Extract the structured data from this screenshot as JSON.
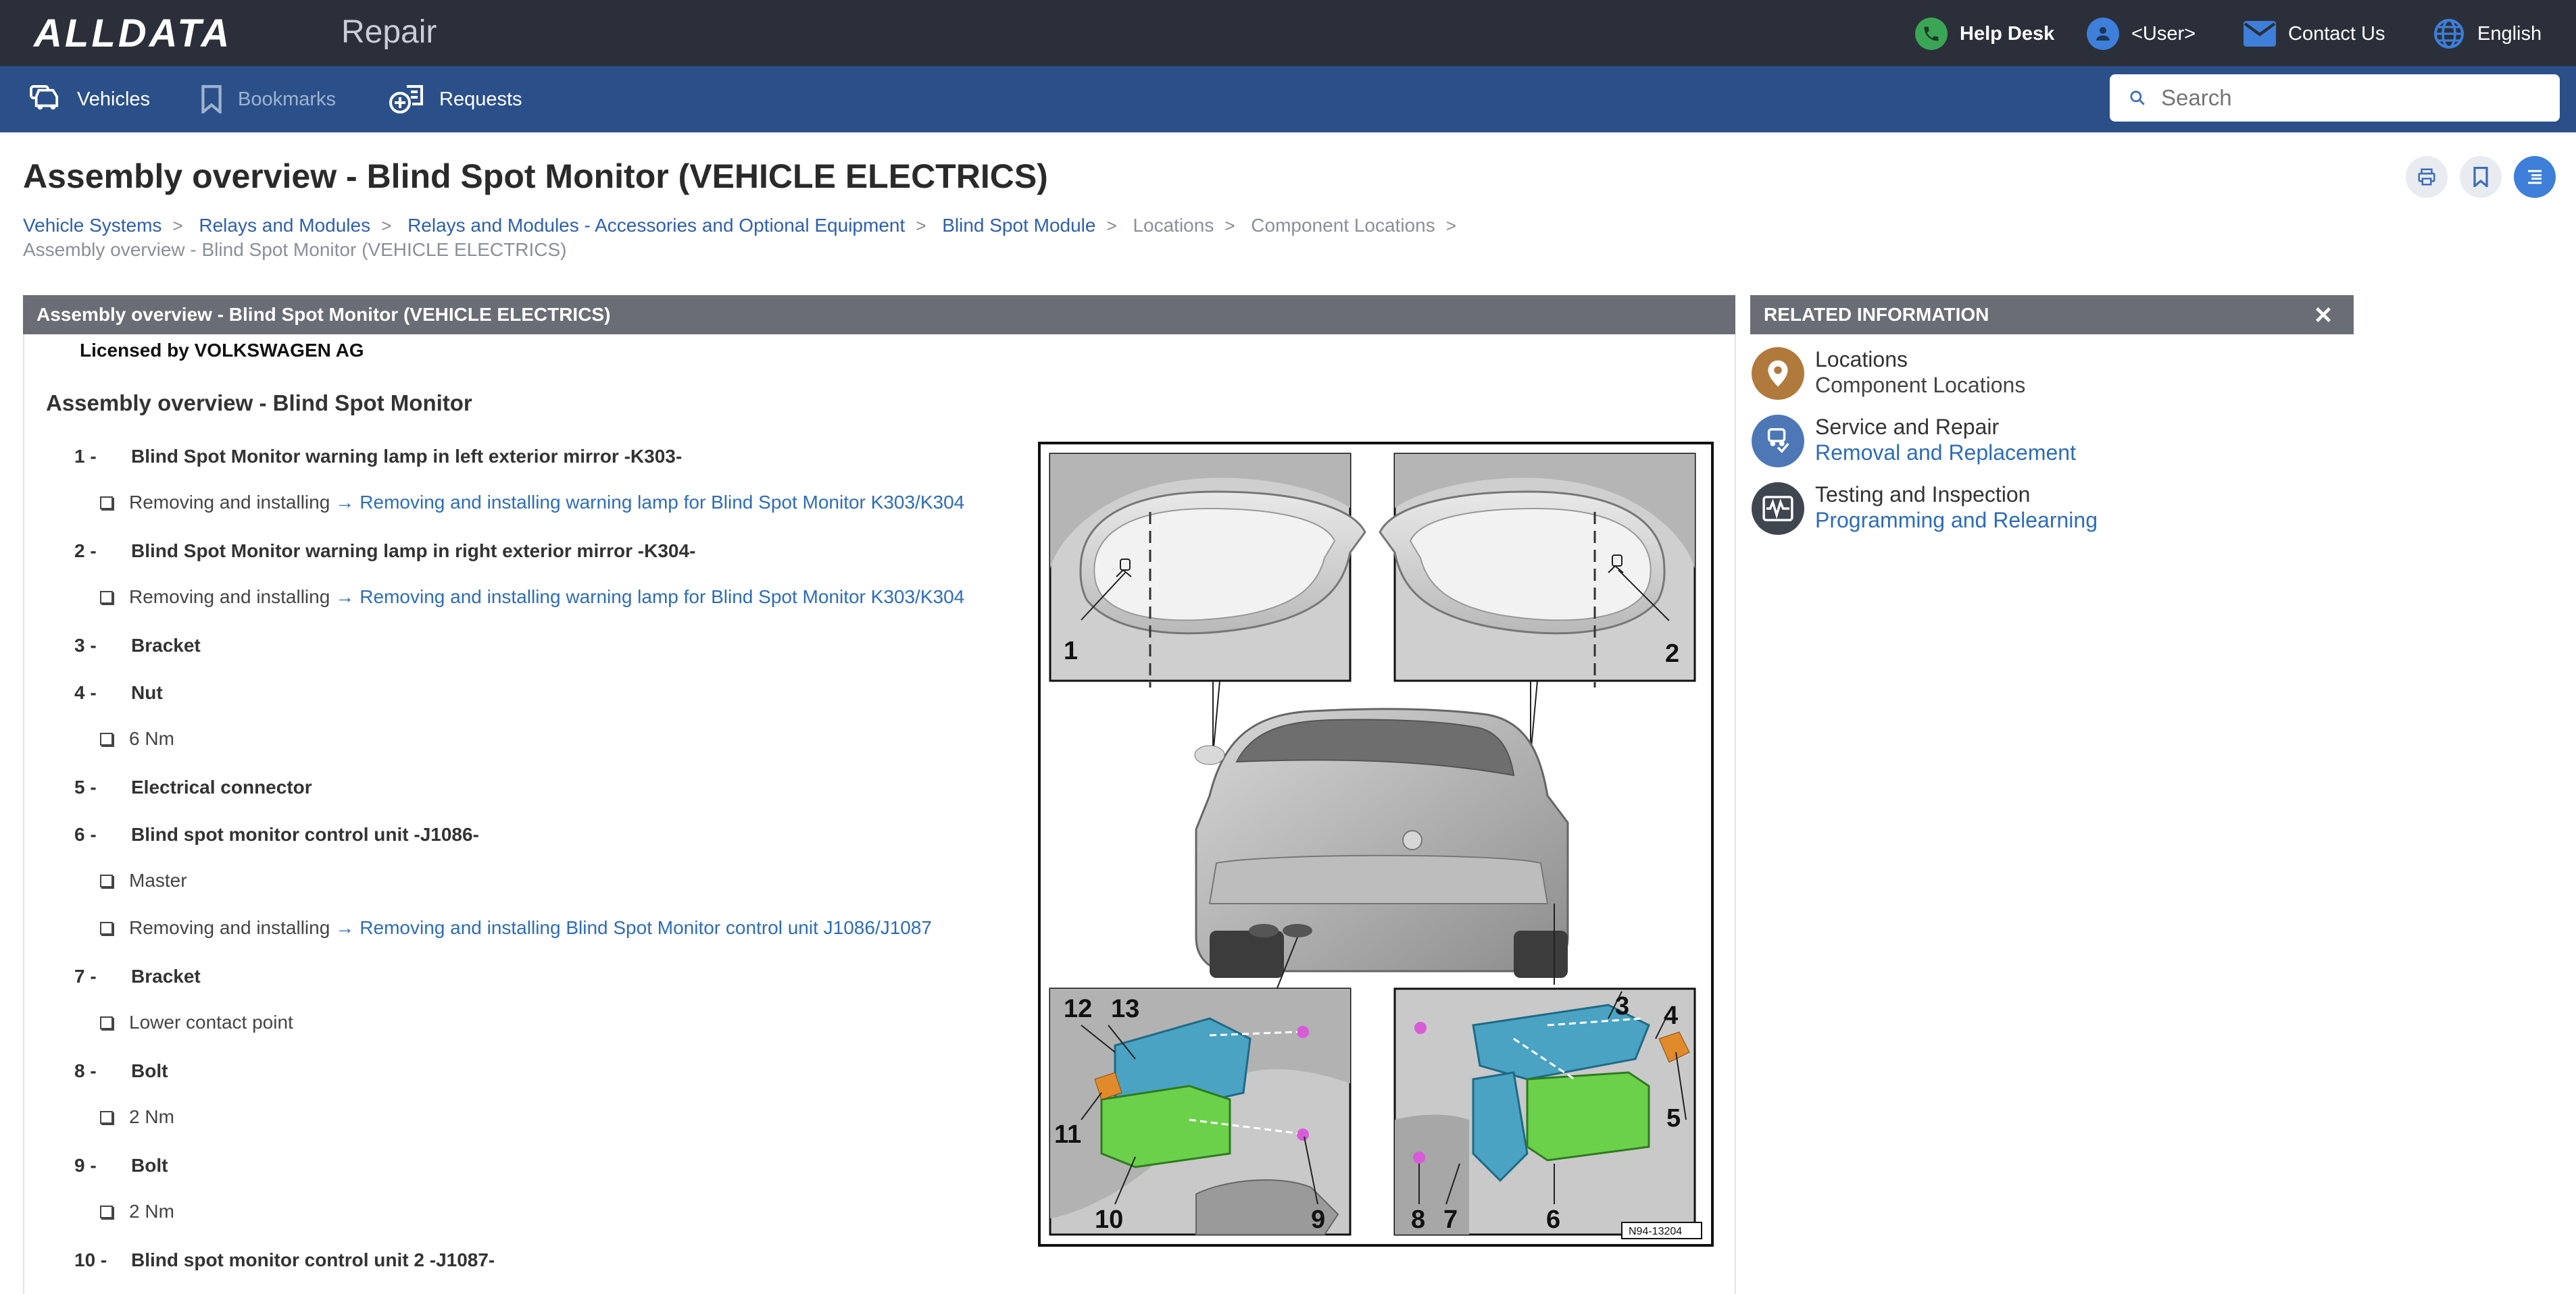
{
  "app": {
    "logo": "ALLDATA",
    "section": "Repair"
  },
  "topbar": {
    "help_desk": "Help Desk",
    "user": "<User>",
    "contact": "Contact Us",
    "language": "English"
  },
  "nav": {
    "vehicles": "Vehicles",
    "bookmarks": "Bookmarks",
    "requests": "Requests"
  },
  "search": {
    "placeholder": "Search"
  },
  "page": {
    "title": "Assembly overview - Blind Spot Monitor (VEHICLE ELECTRICS)"
  },
  "breadcrumb": [
    "Vehicle Systems",
    "Relays and Modules",
    "Relays and Modules - Accessories and Optional Equipment",
    "Blind Spot Module",
    "Locations",
    "Component Locations",
    "Assembly overview - Blind Spot Monitor (VEHICLE ELECTRICS)"
  ],
  "panel": {
    "header": "Assembly overview - Blind Spot Monitor (VEHICLE ELECTRICS)",
    "licensed": "Licensed by VOLKSWAGEN AG",
    "section_title": "Assembly overview - Blind Spot Monitor",
    "items": [
      {
        "num": "1 -",
        "label": "Blind Spot Monitor warning lamp in left exterior mirror -K303-"
      },
      {
        "num": "2 -",
        "label": "Blind Spot Monitor warning lamp in right exterior mirror -K304-"
      },
      {
        "num": "3 -",
        "label": "Bracket"
      },
      {
        "num": "4 -",
        "label": "Nut"
      },
      {
        "num": "5 -",
        "label": "Electrical connector"
      },
      {
        "num": "6 -",
        "label": "Blind spot monitor control unit -J1086-"
      },
      {
        "num": "7 -",
        "label": "Bracket"
      },
      {
        "num": "8 -",
        "label": "Bolt"
      },
      {
        "num": "9 -",
        "label": "Bolt"
      },
      {
        "num": "10 -",
        "label": "Blind spot monitor control unit 2 -J1087-"
      }
    ],
    "subs": {
      "removing_installing": "Removing and installing",
      "arrow": "→",
      "link_lamp": "Removing and installing warning lamp for Blind Spot Monitor K303/K304",
      "torque_6": "6 Nm",
      "master": "Master",
      "link_cu": "Removing and installing Blind Spot Monitor control unit J1086/J1087",
      "lower_contact": "Lower contact point",
      "torque_2": "2 Nm"
    }
  },
  "figure": {
    "callouts": [
      "1",
      "2",
      "3",
      "4",
      "5",
      "6",
      "7",
      "8",
      "9",
      "10",
      "11",
      "12",
      "13"
    ],
    "ref": "N94-13204"
  },
  "related": {
    "header": "RELATED INFORMATION",
    "items": [
      {
        "category": "Locations",
        "link": "Component Locations",
        "color": "#b07a3c"
      },
      {
        "category": "Service and Repair",
        "link": "Removal and Replacement",
        "color": "#4d78b5"
      },
      {
        "category": "Testing and Inspection",
        "link": "Programming and Relearning",
        "color": "#3f4650"
      }
    ]
  },
  "colors": {
    "topbar": "#2b2f3a",
    "navbar": "#2b5089",
    "link": "#2d6cb8",
    "panel_header": "#6a6d75"
  }
}
